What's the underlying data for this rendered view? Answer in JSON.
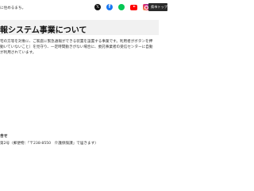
{
  "header": {
    "tagline": "に住めるまち。",
    "top_button_label": "県市トップ",
    "icons": [
      "x-icon",
      "facebook-icon",
      "line-icon",
      "youtube-icon",
      "instagram-icon"
    ]
  },
  "page": {
    "title": "報システム事業について"
  },
  "body": {
    "line1": "宅の方等を対象に、ご家庭に緊急通報ができる装置を設置する事業です。利用者がボタンを押",
    "line2": "動いていないこと）を見守り、一定時間動きがない場合に、委託事業者の受信センターに自動",
    "line3": "が利用されています。"
  },
  "footer": {
    "section_label": "合せ",
    "address": "第2号〈郵便物：「〒238-8550　介護保険課」で届きます〉"
  }
}
